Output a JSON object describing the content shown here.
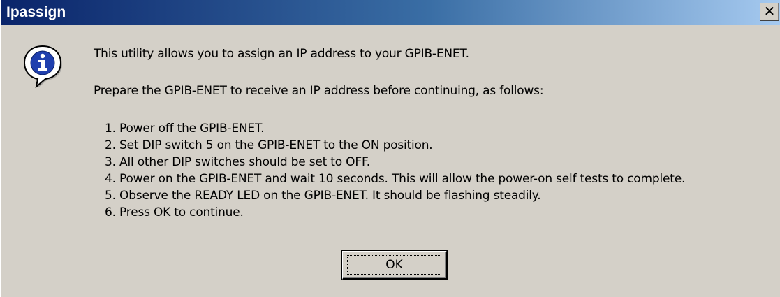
{
  "window": {
    "title": "Ipassign",
    "close_glyph": "✕"
  },
  "icon": {
    "name": "info-icon",
    "glyph": "i"
  },
  "message": {
    "intro": "This utility allows you to assign an IP address to your GPIB-ENET.",
    "prepare": "Prepare the GPIB-ENET to receive an IP address before continuing, as follows:",
    "steps": [
      "1. Power off the GPIB-ENET.",
      "2. Set DIP switch 5 on the GPIB-ENET to the ON position.",
      "3. All other DIP switches should be set to OFF.",
      "4. Power on the GPIB-ENET and wait 10 seconds.  This will allow the power-on self tests to complete.",
      "5. Observe the READY LED on the GPIB-ENET.  It should be flashing steadily.",
      "6. Press OK to continue."
    ]
  },
  "buttons": {
    "ok_label": "OK"
  },
  "colors": {
    "titlebar_start": "#0a246a",
    "titlebar_end": "#a6caf0",
    "face": "#d4d0c8",
    "icon_blue": "#1f3fae"
  }
}
